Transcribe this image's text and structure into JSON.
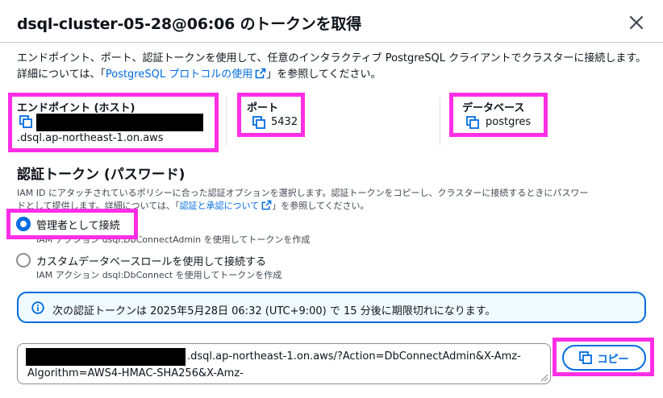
{
  "dialog": {
    "title": "dsql-cluster-05-28@06:06 のトークンを取得",
    "close_icon": "close-icon"
  },
  "intro": {
    "text_before": "エンドポイント、ポート、認証トークンを使用して、任意のインタラクティブ PostgreSQL クライアントでクラスターに接続します。詳細については、「",
    "link_text": "PostgreSQL プロトコルの使用",
    "text_after": "」を参照してください。"
  },
  "fields": {
    "endpoint": {
      "label": "エンドポイント (ホスト)",
      "value_suffix": ".dsql.ap-northeast-1.on.aws"
    },
    "port": {
      "label": "ポート",
      "value": "5432"
    },
    "database": {
      "label": "データベース",
      "value": "postgres"
    }
  },
  "auth": {
    "title": "認証トークン (パスワード)",
    "desc_line1": "IAM ID にアタッチされているポリシーに合った認証オプションを選択します。認証トークンをコピーし、クラスターに接続するときにパスワー",
    "desc_line2_before": "ドとして提供します。詳細については、「",
    "desc_link": "認証と承認について",
    "desc_line2_after": "」を参照してください。",
    "options": [
      {
        "label": "管理者として接続",
        "sub": "IAM アクション dsql:DbConnectAdmin を使用してトークンを作成",
        "selected": true
      },
      {
        "label": "カスタムデータベースロールを使用して接続する",
        "sub": "IAM アクション dsql:DbConnect を使用してトークンを作成",
        "selected": false
      }
    ]
  },
  "alert": {
    "text": "次の認証トークンは 2025年5月28日 06:32 (UTC+9:00) で 15 分後に期限切れになります。"
  },
  "token": {
    "line1_visible": ".dsql.ap-northeast-1.on.aws/?Action=DbConnectAdmin&X-Amz-",
    "line2": "Algorithm=AWS4-HMAC-SHA256&X-Amz-"
  },
  "copy_button": {
    "label": "コピー"
  },
  "colors": {
    "accent": "#006ce0",
    "highlight": "#ff2ee6",
    "redaction": "#000000"
  }
}
